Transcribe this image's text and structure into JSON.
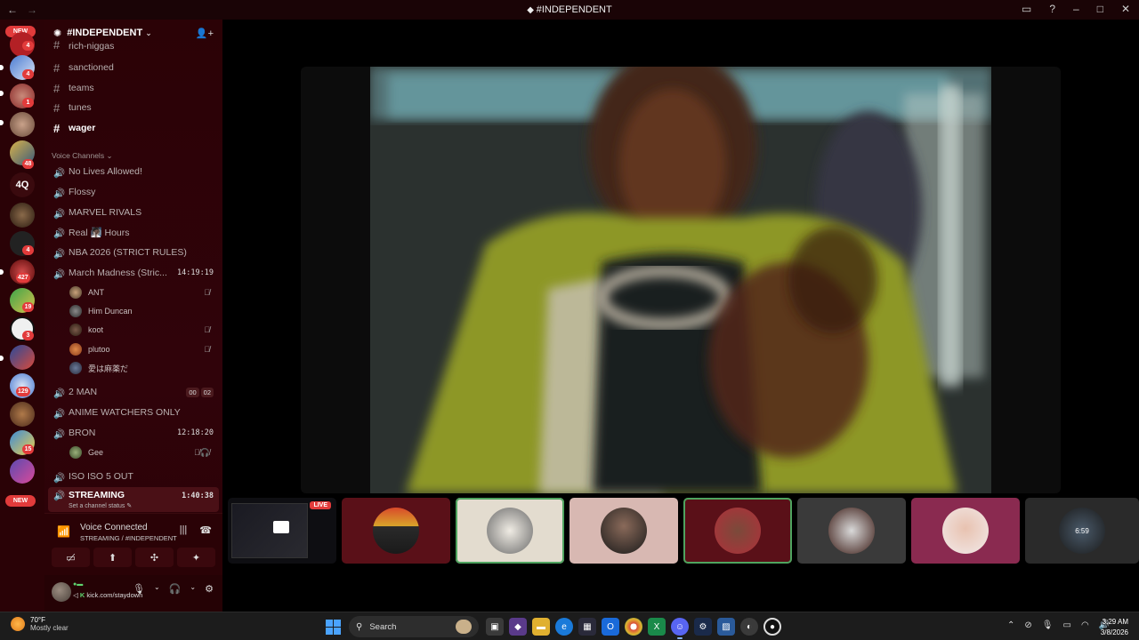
{
  "window": {
    "title": "#INDEPENDENT",
    "back": "←",
    "forward": "→"
  },
  "guilds": {
    "new_top": "NEW",
    "new_bottom": "NEW",
    "badges": [
      "4",
      "4",
      "1",
      "48",
      "4",
      "427",
      "19",
      "3",
      "129",
      "15"
    ],
    "text_server": "4Q"
  },
  "server": {
    "name": "#INDEPENDENT"
  },
  "text_channels": [
    {
      "name": "rich-niggas"
    },
    {
      "name": "sanctioned"
    },
    {
      "name": "teams"
    },
    {
      "name": "tunes"
    },
    {
      "name": "wager"
    }
  ],
  "voice_category": "Voice Channels",
  "voice_channels": {
    "c1": "No Lives Allowed!",
    "c2": "Flossy",
    "c3": "MARVEL RIVALS",
    "c4": "Real 🧖🏿 Hours",
    "c5": "NBA 2026 (STRICT RULES)",
    "c6": "March Madness (Stric...",
    "c6_time": "14:19:19",
    "c6_users": [
      "ANT",
      "Him Duncan",
      "koot",
      "plutoo",
      "愛は麻薬だ"
    ],
    "c7": "2 MAN",
    "c7_count_a": "00",
    "c7_count_b": "02",
    "c8": "ANIME WATCHERS ONLY",
    "c9": "BRON",
    "c9_time": "12:18:20",
    "c9_user": "Gee",
    "c10": "ISO ISO 5 OUT",
    "c11": "STREAMING",
    "c11_time": "1:40:38",
    "c11_status": "Set a channel status"
  },
  "voice_panel": {
    "status": "Voice Connected",
    "channel": "STREAMING / #INDEPENDENT"
  },
  "user_panel": {
    "status_line": "kick.com/staydown"
  },
  "stage": {
    "live_badge": "LIVE",
    "clock_thumb": "6:59"
  },
  "taskbar": {
    "temp": "70°F",
    "weather": "Mostly clear",
    "search": "Search",
    "time": "3:29 AM",
    "date": "3/8/2026"
  }
}
